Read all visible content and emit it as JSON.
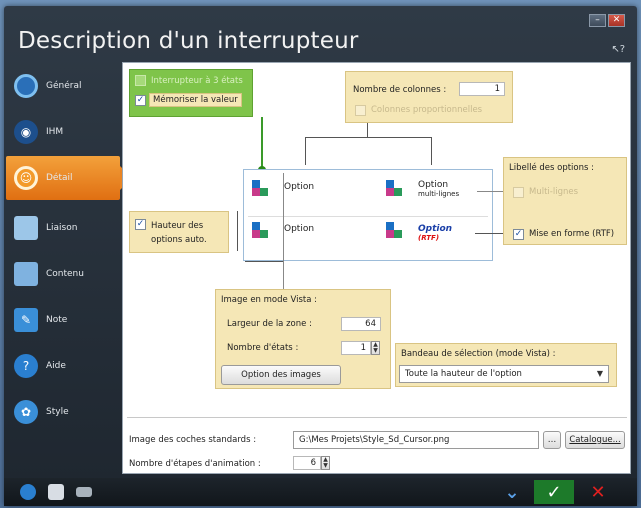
{
  "window": {
    "title": "Description d'un interrupteur"
  },
  "sidebar": {
    "items": [
      {
        "label": "Général",
        "icon": "ring-icon",
        "color": "#3a8fd8"
      },
      {
        "label": "IHM",
        "icon": "eye-icon",
        "color": "#2a6fb8"
      },
      {
        "label": "Détail",
        "icon": "ring-icon",
        "color": "#e98524",
        "active": true
      },
      {
        "label": "Liaison",
        "icon": "document-icon",
        "color": "#8fb8dc"
      },
      {
        "label": "Contenu",
        "icon": "document-icon",
        "color": "#6fa8d8"
      },
      {
        "label": "Note",
        "icon": "note-icon",
        "color": "#3a8fd8"
      },
      {
        "label": "Aide",
        "icon": "help-icon",
        "color": "#2a7fd0"
      },
      {
        "label": "Style",
        "icon": "style-icon",
        "color": "#3a8fd8"
      }
    ]
  },
  "details": {
    "interrupteur_3_etats": "Interrupteur à 3 états",
    "memoriser": "Mémoriser la valeur",
    "nb_colonnes_label": "Nombre de colonnes :",
    "nb_colonnes_value": "1",
    "colonnes_prop": "Colonnes proportionnelles",
    "libelle_options": "Libellé des options :",
    "multi_lignes": "Multi-lignes",
    "mise_en_forme": "Mise en forme (RTF)",
    "hauteur_options": "Hauteur des options auto.",
    "option_1": "Option",
    "option_2": "Option",
    "option_3_line1": "Option",
    "option_3_line2": "multi-lignes",
    "option_4_line1": "Option",
    "option_4_line2": "(RTF)",
    "image_vista_title": "Image en mode Vista :",
    "largeur_label": "Largeur de la zone :",
    "largeur_value": "64",
    "etats_label": "Nombre d'états :",
    "etats_value": "1",
    "option_images_btn": "Option des images",
    "bandeau_title": "Bandeau de sélection (mode Vista) :",
    "bandeau_value": "Toute la hauteur de l'option",
    "image_coches_label": "Image des coches standards :",
    "image_coches_value": "G:\\Mes Projets\\Style_Sd_Cursor.png",
    "catalogue_btn": "Catalogue...",
    "etapes_label": "Nombre d'étapes d'animation :",
    "etapes_value": "6"
  },
  "window_buttons": {
    "minimize": "–",
    "maximize": "□",
    "close": "✕"
  },
  "colors": {
    "panel": "#f5e7b6",
    "active_tab": "#e98524",
    "memoriser_panel": "#7fc44a",
    "ok": "#3ac43a",
    "cancel": "#e02020"
  }
}
